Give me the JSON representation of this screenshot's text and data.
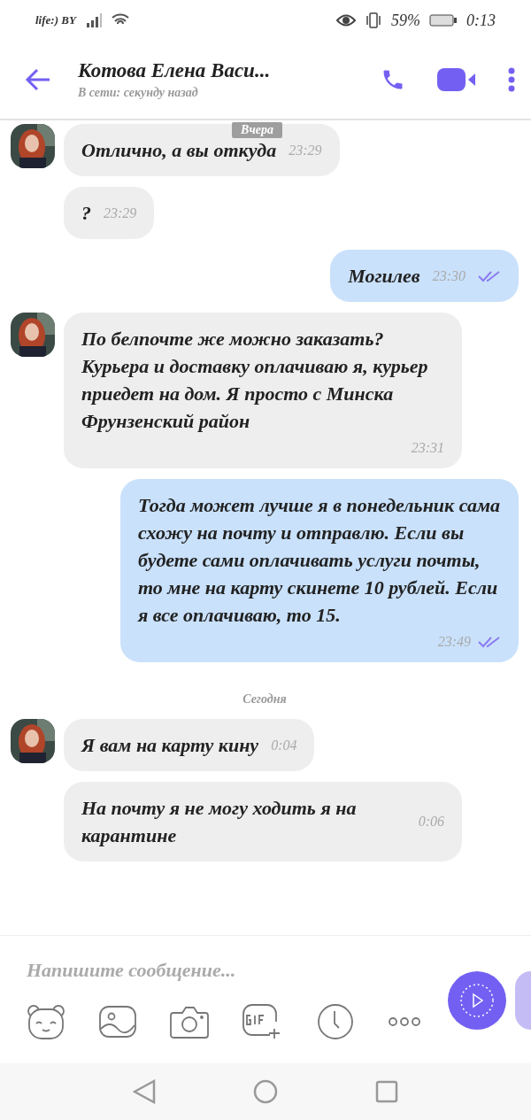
{
  "status_bar": {
    "carrier": "life:) BY",
    "battery": "59%",
    "time": "0:13"
  },
  "header": {
    "title": "Котова Елена Васи...",
    "subtitle": "В сети: секунду назад"
  },
  "floating_date": "Вчера",
  "messages": [
    {
      "kind": "incoming",
      "avatar": true,
      "text": "Отлично, а вы откуда",
      "time": "23:29"
    },
    {
      "kind": "incoming",
      "avatar": false,
      "text": "?",
      "time": "23:29"
    },
    {
      "kind": "outgoing",
      "text": "Могилев",
      "time": "23:30",
      "read": true
    },
    {
      "kind": "incoming",
      "avatar": true,
      "text": "По белпочте же можно заказать? Курьера и доставку оплачиваю я, курьер приедет на дом. Я просто с Минска Фрунзенский район",
      "time": "23:31"
    },
    {
      "kind": "outgoing",
      "text": "Тогда может лучше я в понедельник сама схожу на почту и отправлю. Если вы будете сами оплачивать услуги почты, то мне на карту скинете 10 рублей. Если я все оплачиваю, то 15.",
      "time": "23:49",
      "read": true
    },
    {
      "kind": "date",
      "text": "Сегодня"
    },
    {
      "kind": "incoming",
      "avatar": true,
      "text": "Я вам на карту кину",
      "time": "0:04"
    },
    {
      "kind": "incoming",
      "avatar": false,
      "text": "На почту я не могу ходить я на карантине",
      "time": "0:06"
    }
  ],
  "composer": {
    "placeholder": "Напишите сообщение..."
  }
}
